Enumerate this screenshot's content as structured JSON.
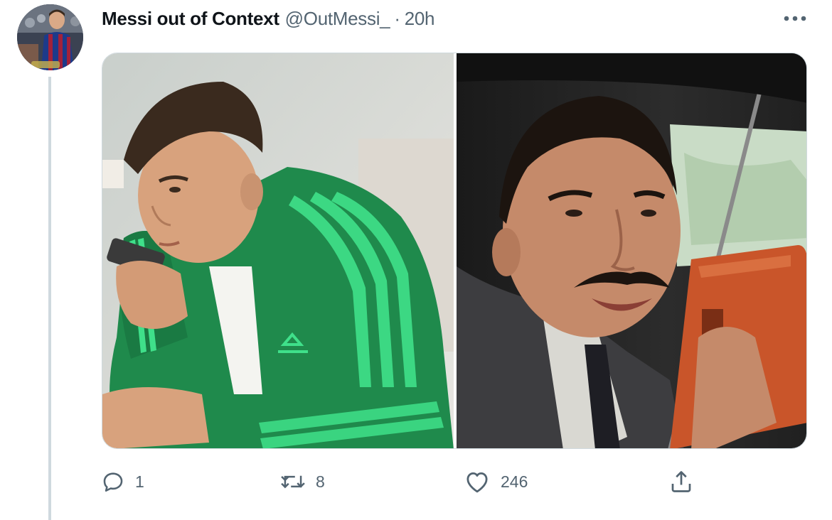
{
  "tweet": {
    "display_name": "Messi out of Context",
    "handle": "@OutMessi_",
    "separator": "·",
    "time": "20h"
  },
  "avatar": {
    "description": "profile photo of a footballer in a blue and red striped kit"
  },
  "media": {
    "left_photo": "man in green tracksuit speaking into phone",
    "right_photo": "man with moustache in suit speaking into radio"
  },
  "actions": {
    "reply_count": "1",
    "retweet_count": "8",
    "like_count": "246"
  },
  "colors": {
    "text_primary": "#0f1419",
    "text_secondary": "#536471",
    "thread_line": "#cfd9de",
    "accent_green": "#1f8a4c"
  },
  "icons": [
    "more-icon",
    "reply-icon",
    "retweet-icon",
    "like-icon",
    "share-icon"
  ]
}
